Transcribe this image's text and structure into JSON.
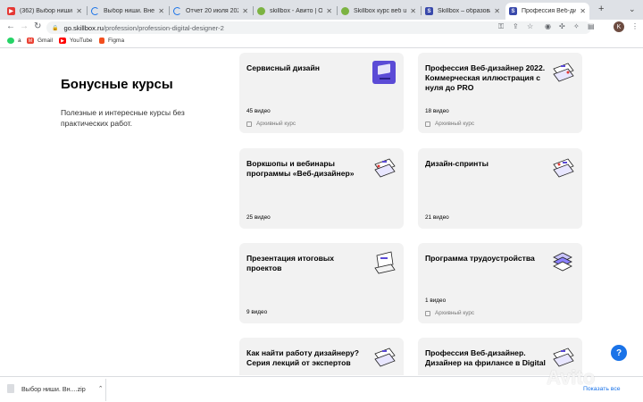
{
  "tabs": [
    {
      "title": "(362) Выбор ниши. Вн",
      "favicon": "youtube-icon",
      "color": "#e53935"
    },
    {
      "title": "Выбор ниши. Внешн",
      "favicon": "loading-icon",
      "color": "#1a73e8"
    },
    {
      "title": "Отчет 20 июля 2022",
      "favicon": "loading-icon",
      "color": "#1a73e8"
    },
    {
      "title": "skillbox - Авито | Объ",
      "favicon": "avito-icon",
      "color": "#7cb342"
    },
    {
      "title": "Skillbox курс веб ui",
      "favicon": "avito-icon",
      "color": "#7cb342"
    },
    {
      "title": "Skillbox – образоват",
      "favicon": "skillbox-icon",
      "color": "#3949ab"
    },
    {
      "title": "Профессия Веб-ди",
      "favicon": "skillbox-icon",
      "color": "#3949ab",
      "active": true
    }
  ],
  "toolbar": {
    "url_host": "go.skillbox.ru",
    "url_path": "/profession/profession-digital-designer-2",
    "avatar_letter": "K"
  },
  "bookmarks": [
    {
      "label": "a",
      "icon": "whatsapp-icon",
      "color": "#25d366"
    },
    {
      "label": "Gmail",
      "icon": "gmail-icon",
      "color": "#ea4335"
    },
    {
      "label": "YouTube",
      "icon": "youtube-icon",
      "color": "#ff0000"
    },
    {
      "label": "Figma",
      "icon": "figma-icon",
      "color": "#f24e1e"
    }
  ],
  "section": {
    "title": "Бонусные курсы",
    "description": "Полезные и интересные курсы без практических работ."
  },
  "cards": [
    {
      "title": "Сервисный дизайн",
      "count": "45 видео",
      "archive": "Архивный курс",
      "illustration": "purple-screen-icon"
    },
    {
      "title": "Профессия Веб-дизайнер 2022. Коммерческая иллюстрация с нуля до PRO",
      "count": "18 видео",
      "archive": "Архивный курс",
      "illustration": "design-layers-icon"
    },
    {
      "title": "Воркшопы и вебинары программы «Веб-дизайнер»",
      "count": "25 видео",
      "archive": "",
      "illustration": "design-layers-icon"
    },
    {
      "title": "Дизайн-спринты",
      "count": "21 видео",
      "archive": "",
      "illustration": "design-layers-icon"
    },
    {
      "title": "Презентация итоговых проектов",
      "count": "9 видео",
      "archive": "",
      "illustration": "presentation-icon"
    },
    {
      "title": "Программа трудоустройства",
      "count": "1 видео",
      "archive": "Архивный курс",
      "illustration": "stack-icon"
    },
    {
      "title": "Как найти работу дизайнеру? Серия лекций от экспертов",
      "count": "",
      "archive": "",
      "illustration": "design-layers-icon"
    },
    {
      "title": "Профессия Веб-дизайнер. Дизайнер на фрилансе в Digital",
      "count": "",
      "archive": "",
      "illustration": "design-layers-icon"
    }
  ],
  "help": {
    "label": "?"
  },
  "downloads": {
    "file": "Выбор ниши. Вн....zip",
    "show_all": "Показать все"
  },
  "watermark": "Avito"
}
